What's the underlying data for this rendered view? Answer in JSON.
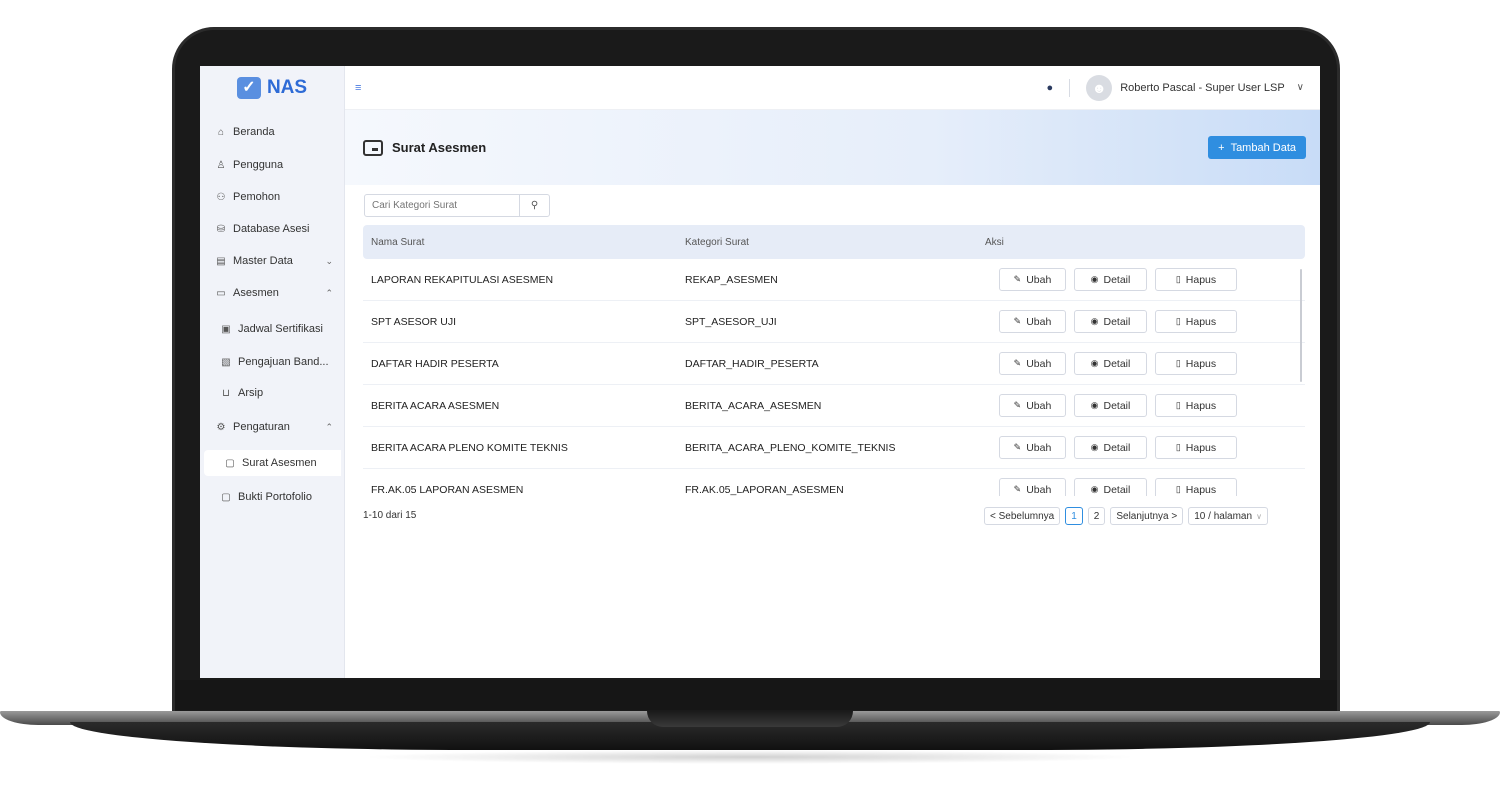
{
  "app": {
    "logo_text": "NAS",
    "logo_mark": "✓"
  },
  "sidebar": {
    "items": [
      {
        "label": "Beranda",
        "icon": "home-icon",
        "glyph": "⌂"
      },
      {
        "label": "Pengguna",
        "icon": "user-icon",
        "glyph": "♙"
      },
      {
        "label": "Pemohon",
        "icon": "users-icon",
        "glyph": "⚇"
      },
      {
        "label": "Database Asesi",
        "icon": "database-icon",
        "glyph": "⛁"
      },
      {
        "label": "Master Data",
        "icon": "archive-icon",
        "glyph": "▤",
        "chevron": "⌄"
      },
      {
        "label": "Asesmen",
        "icon": "card-icon",
        "glyph": "▭",
        "chevron": "⌃"
      },
      {
        "label": "Jadwal Sertifikasi",
        "icon": "calendar-icon",
        "glyph": "▣"
      },
      {
        "label": "Pengajuan Band...",
        "icon": "document-icon",
        "glyph": "▧"
      },
      {
        "label": "Arsip",
        "icon": "folder-icon",
        "glyph": "⊔"
      },
      {
        "label": "Pengaturan",
        "icon": "settings-icon",
        "glyph": "⚙",
        "chevron": "⌃"
      },
      {
        "label": "Surat Asesmen",
        "icon": "folder-icon",
        "glyph": "▢"
      },
      {
        "label": "Bukti Portofolio",
        "icon": "folder-icon",
        "glyph": "▢"
      }
    ]
  },
  "topbar": {
    "menu_glyph": "≡",
    "bell_glyph": "🔔",
    "user_name": "Roberto Pascal - Super User LSP",
    "user_chevron": "∨"
  },
  "header": {
    "title": "Surat Asesmen",
    "add_button": "Tambah Data",
    "add_glyph": "+"
  },
  "search": {
    "placeholder": "Cari Kategori Surat",
    "icon_glyph": "⚲"
  },
  "table": {
    "columns": [
      "Nama Surat",
      "Kategori Surat",
      "Aksi"
    ],
    "actions": {
      "edit": "Ubah",
      "detail": "Detail",
      "delete": "Hapus",
      "edit_glyph": "✎",
      "detail_glyph": "◉",
      "delete_glyph": "▯"
    },
    "rows": [
      {
        "name": "LAPORAN REKAPITULASI ASESMEN",
        "category": "REKAP_ASESMEN"
      },
      {
        "name": "SPT ASESOR UJI",
        "category": "SPT_ASESOR_UJI"
      },
      {
        "name": "DAFTAR HADIR PESERTA",
        "category": "DAFTAR_HADIR_PESERTA"
      },
      {
        "name": "BERITA ACARA ASESMEN",
        "category": "BERITA_ACARA_ASESMEN"
      },
      {
        "name": "BERITA ACARA PLENO KOMITE TEKNIS",
        "category": "BERITA_ACARA_PLENO_KOMITE_TEKNIS"
      },
      {
        "name": "FR.AK.05 LAPORAN ASESMEN",
        "category": "FR.AK.05_LAPORAN_ASESMEN"
      }
    ]
  },
  "pagination": {
    "summary": "1-10 dari 15",
    "prev": "< Sebelumnya",
    "pages": [
      "1",
      "2"
    ],
    "next": "Selanjutnya >",
    "page_size": "10 / halaman",
    "page_size_chevron": "∨"
  },
  "colors": {
    "accent": "#2f8ee0",
    "logo_blue": "#2e6bd6",
    "table_header": "#e6ecf7",
    "sidebar_bg": "#f1f3f9"
  }
}
